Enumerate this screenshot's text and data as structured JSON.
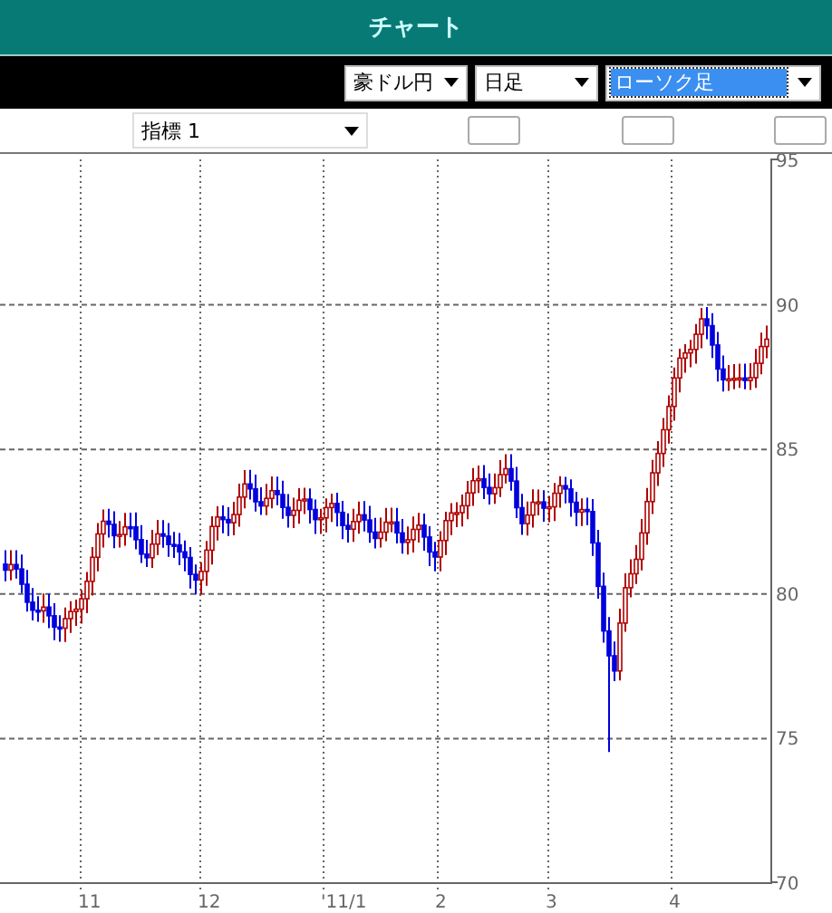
{
  "window": {
    "title": "チャート"
  },
  "toolbar": {
    "dropdowns": [
      {
        "value": "豪ドル円",
        "focused": false
      },
      {
        "value": "日足",
        "focused": false
      },
      {
        "value": "ローソク足",
        "focused": true
      }
    ]
  },
  "indicator_row": {
    "dropdown": {
      "value": "指標 1"
    }
  },
  "chart": {
    "y_labels": [
      "95",
      "90",
      "85",
      "80",
      "75",
      "70"
    ],
    "x_labels": [
      "11",
      "12",
      "'11/1",
      "2",
      "3",
      "4"
    ]
  }
}
